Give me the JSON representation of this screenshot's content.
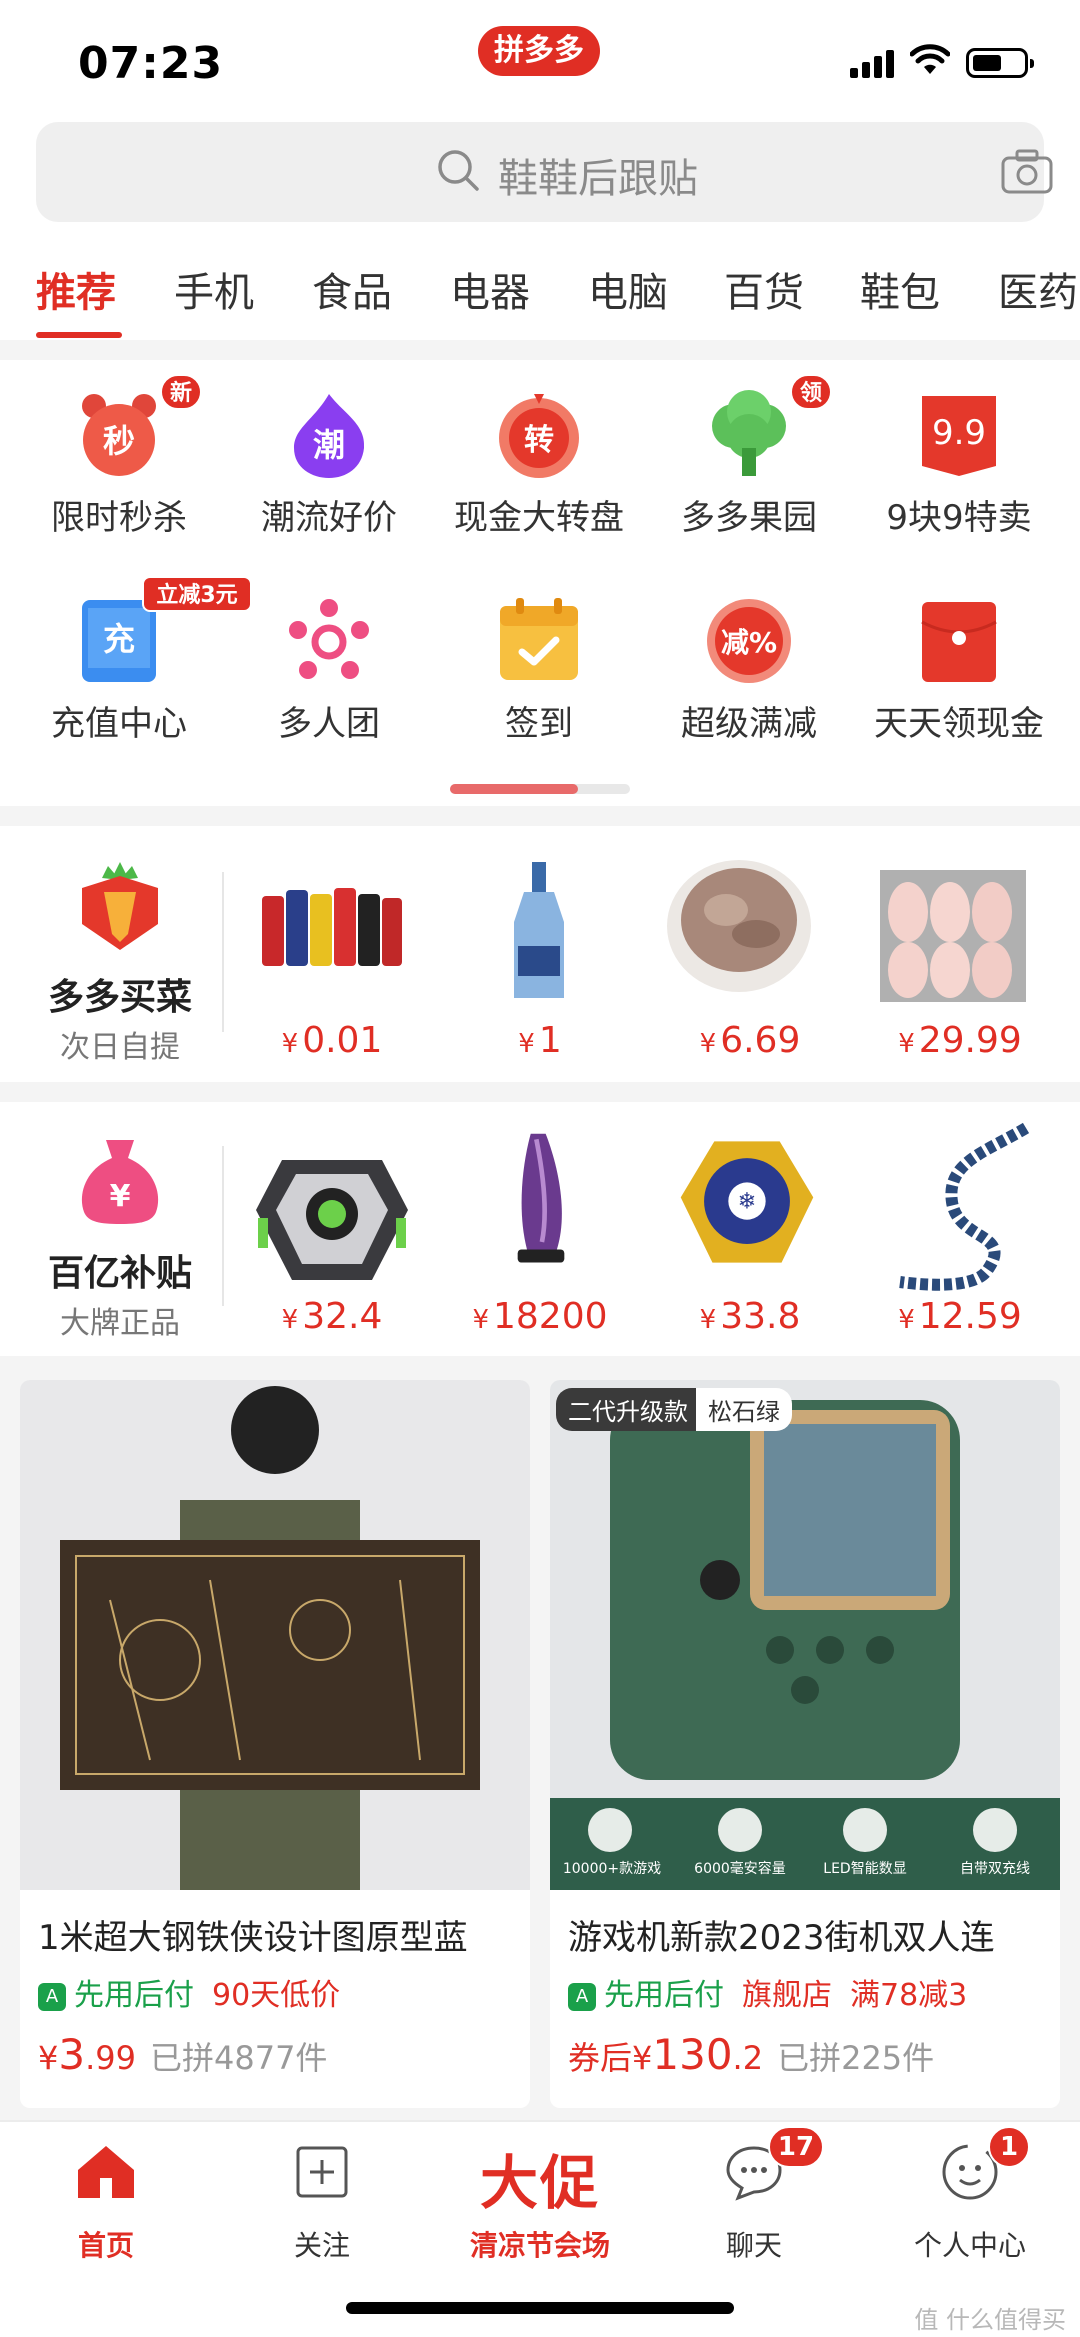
{
  "status_bar": {
    "time": "07:23",
    "app_badge": "拼多多"
  },
  "search": {
    "placeholder": "鞋鞋后跟贴"
  },
  "tabs": [
    "推荐",
    "手机",
    "食品",
    "电器",
    "电脑",
    "百货",
    "鞋包",
    "医药"
  ],
  "shortcuts": [
    {
      "label": "限时秒杀",
      "icon": "alarm-clock-icon",
      "glyph": "秒",
      "badge": "新"
    },
    {
      "label": "潮流好价",
      "icon": "flame-icon",
      "glyph": "潮"
    },
    {
      "label": "现金大转盘",
      "icon": "wheel-icon",
      "glyph": "转"
    },
    {
      "label": "多多果园",
      "icon": "tree-icon",
      "badge": "领"
    },
    {
      "label": "9块9特卖",
      "icon": "tag-icon",
      "glyph": "9.9"
    },
    {
      "label": "充值中心",
      "icon": "phone-recharge-icon",
      "glyph": "充",
      "badge": "立减3元"
    },
    {
      "label": "多人团",
      "icon": "group-icon"
    },
    {
      "label": "签到",
      "icon": "calendar-check-icon"
    },
    {
      "label": "超级满减",
      "icon": "discount-icon",
      "glyph": "减%"
    },
    {
      "label": "天天领现金",
      "icon": "red-envelope-icon"
    }
  ],
  "grocery": {
    "title": "多多买菜",
    "subtitle": "次日自提",
    "currency": "¥",
    "prices": [
      "0.01",
      "1",
      "6.69",
      "29.99"
    ]
  },
  "subsidy": {
    "title": "百亿补贴",
    "subtitle": "大牌正品",
    "currency": "¥",
    "prices": [
      "32.4",
      "18200",
      "33.8",
      "12.59"
    ]
  },
  "products": [
    {
      "title": "1米超大钢铁侠设计图原型蓝",
      "tag1": "先用后付",
      "tag2": "90天低价",
      "price_prefix": "",
      "currency": "¥",
      "price_int": "3",
      "price_dec": ".99",
      "sold": "已拼4877件"
    },
    {
      "title": "游戏机新款2023街机双人连",
      "tag1": "先用后付",
      "tag2": "旗舰店",
      "tag3": "满78减3",
      "price_prefix": "券后",
      "currency": "¥",
      "price_int": "130",
      "price_dec": ".2",
      "sold": "已拼225件",
      "img_tag_1": "二代升级款",
      "img_tag_2": "松石绿",
      "features": [
        "10000+款游戏",
        "6000毫安容量",
        "LED智能数显",
        "自带双充线"
      ]
    }
  ],
  "bottom_nav": [
    {
      "label": "首页",
      "icon": "home-icon",
      "active": true
    },
    {
      "label": "关注",
      "icon": "plus-box-icon"
    },
    {
      "label": "清凉节会场",
      "big": "大促"
    },
    {
      "label": "聊天",
      "icon": "chat-icon",
      "badge": "17"
    },
    {
      "label": "个人中心",
      "icon": "profile-icon",
      "badge": "1"
    }
  ],
  "watermark": "值 什么值得买"
}
